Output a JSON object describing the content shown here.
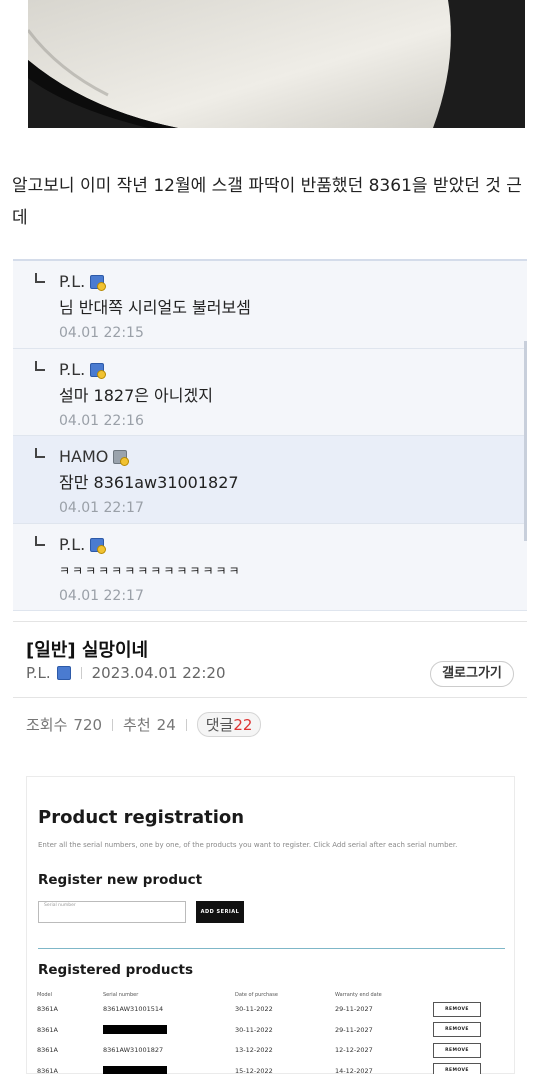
{
  "post_body": "알고보니 이미 작년 12월에 스갤 파딱이 반품했던 8361을 받았던 것 근데",
  "comments": [
    {
      "nick": "P.L.",
      "body": "님 반대쪽 시리얼도 불러보셈",
      "time": "04.01 22:15",
      "badge": "blue"
    },
    {
      "nick": "P.L.",
      "body": "설마 1827은 아니겠지",
      "time": "04.01 22:16",
      "badge": "blue"
    },
    {
      "nick": "HAMO",
      "body": "잠만 8361aw31001827",
      "time": "04.01 22:17",
      "badge": "gray"
    },
    {
      "nick": "P.L.",
      "body": "ㅋㅋㅋㅋㅋㅋㅋㅋㅋㅋㅋㅋㅋㅋ",
      "time": "04.01 22:17",
      "badge": "blue"
    }
  ],
  "post": {
    "category": "[일반]",
    "title": "실망이네",
    "author": "P.L.",
    "datetime": "2023.04.01 22:20",
    "gallery_button": "갤로그가기",
    "views_label": "조회수",
    "views": "720",
    "recommend_label": "추천",
    "recommend": "24",
    "comments_label": "댓글",
    "comments_count": "22"
  },
  "registration": {
    "title": "Product registration",
    "intro": "Enter all the serial numbers, one by one, of the products you want to register. Click Add serial after each serial number.",
    "new_heading": "Register new product",
    "serial_label": "Serial number",
    "add_button": "ADD SERIAL",
    "registered_heading": "Registered products",
    "columns": [
      "Model",
      "Serial number",
      "Date of purchase",
      "Warranty end date"
    ],
    "rows": [
      {
        "model": "8361A",
        "serial": "8361AW31001514",
        "purchase": "30-11-2022",
        "warranty": "29-11-2027",
        "redacted": false
      },
      {
        "model": "8361A",
        "serial": "",
        "purchase": "30-11-2022",
        "warranty": "29-11-2027",
        "redacted": true
      },
      {
        "model": "8361A",
        "serial": "8361AW31001827",
        "purchase": "13-12-2022",
        "warranty": "12-12-2027",
        "redacted": false
      },
      {
        "model": "8361A",
        "serial": "",
        "purchase": "15-12-2022",
        "warranty": "14-12-2027",
        "redacted": true
      }
    ],
    "remove_label": "REMOVE"
  }
}
